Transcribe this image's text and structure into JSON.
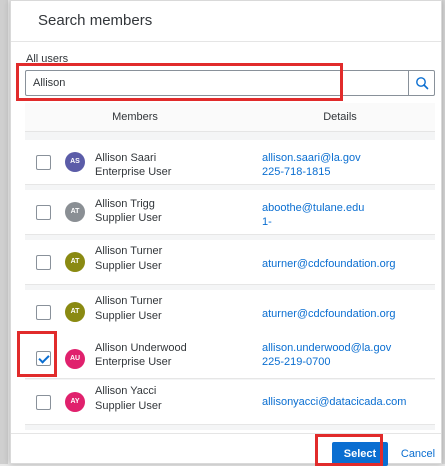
{
  "dialog": {
    "title": "Search members",
    "filter_label": "All users",
    "search": {
      "value": "Allison",
      "placeholder": ""
    },
    "columns": {
      "members": "Members",
      "details": "Details"
    },
    "members": [
      {
        "initials": "AS",
        "color": "#5b5ca8",
        "name": "Allison Saari",
        "type": "Enterprise User",
        "email": "allison.saari@la.gov",
        "phone": "225-718-1815",
        "checked": false
      },
      {
        "initials": "AT",
        "color": "#8a8f94",
        "name": "Allison Trigg",
        "type": "Supplier User",
        "email": "aboothe@tulane.edu",
        "phone": "1-",
        "checked": false
      },
      {
        "initials": "AT",
        "color": "#8a8a12",
        "name": "Allison Turner",
        "type": "Supplier User",
        "email": "aturner@cdcfoundation.org",
        "phone": "",
        "checked": false
      },
      {
        "initials": "AT",
        "color": "#8a8a12",
        "name": "Allison Turner",
        "type": "Supplier User",
        "email": "aturner@cdcfoundation.org",
        "phone": "",
        "checked": false
      },
      {
        "initials": "AU",
        "color": "#e0216d",
        "name": "Allison Underwood",
        "type": "Enterprise User",
        "email": "allison.underwood@la.gov",
        "phone": "225-219-0700",
        "checked": true
      },
      {
        "initials": "AY",
        "color": "#e0216d",
        "name": "Allison Yacci",
        "type": "Supplier User",
        "email": "allisonyacci@datacicada.com",
        "phone": "",
        "checked": false
      }
    ],
    "footer": {
      "select_label": "Select",
      "cancel_label": "Cancel"
    }
  }
}
